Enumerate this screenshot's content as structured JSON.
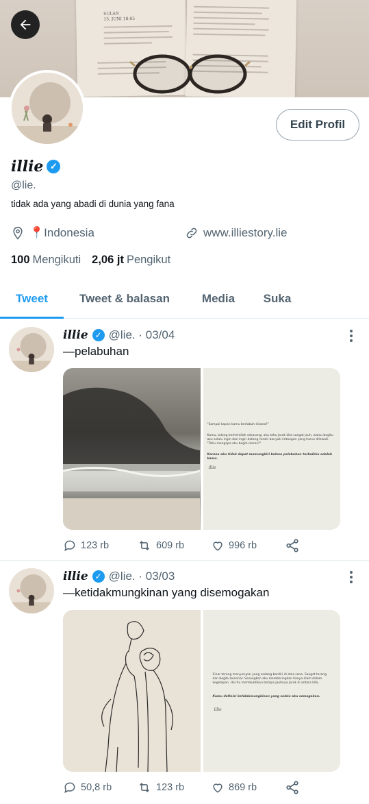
{
  "profile": {
    "display_name": "illie",
    "handle": "@lie.",
    "bio": "tidak ada yang abadi di dunia yang fana",
    "location": "📍Indonesia",
    "website": "www.illiestory.lie",
    "following_count": "100",
    "following_label": "Mengikuti",
    "followers_count": "2,06 jt",
    "followers_label": "Pengikut",
    "edit_button": "Edit Profil"
  },
  "banner": {
    "book_heading_left": "SULAN",
    "book_date_left": "15, JUNI 18:05"
  },
  "tabs": [
    {
      "label": "Tweet"
    },
    {
      "label": "Tweet & balasan"
    },
    {
      "label": "Media"
    },
    {
      "label": "Suka"
    }
  ],
  "tweets": [
    {
      "name": "illie",
      "handle_date": "@lie. · 03/04",
      "text": "—pelabuhan",
      "note_lines": [
        "\"Sampai kapan kamu berlabuh disana?\"",
        "Kamu, tolong berhentilah sekarang; aku tahu jarak kita sangat jauh, walau begitu aku selalu ingin dan ingin datang meski banyak rintangan yang harus dilewati. \"Tahu mengapa aku begitu keras?\"",
        "Karena aku tidak dapat memungkiri bahwa pelabuhan terbaikku adalah kamu."
      ],
      "replies": "123 rb",
      "retweets": "609 rb",
      "likes": "996 rb"
    },
    {
      "name": "illie",
      "handle_date": "@lie. · 03/03",
      "text": "—ketidakmungkinan yang disemogakan",
      "note_lines": [
        "Sinar terang menyerupai yang sedang berdiri di atas sana. Sangat terang dan begitu bersinar. Sesangkan aku membaringkan hanya diam dalam kegelapan. Hal itu membuktikan betapa jauhnya jarak di antara kita.",
        "Kamu definisi ketidakmungkinan yang selalu aku semogakan."
      ],
      "replies": "50,8 rb",
      "retweets": "123 rb",
      "likes": "869 rb"
    }
  ],
  "colors": {
    "accent": "#1d9bf0",
    "secondary_text": "#536471",
    "primary_text": "#0f1419"
  }
}
